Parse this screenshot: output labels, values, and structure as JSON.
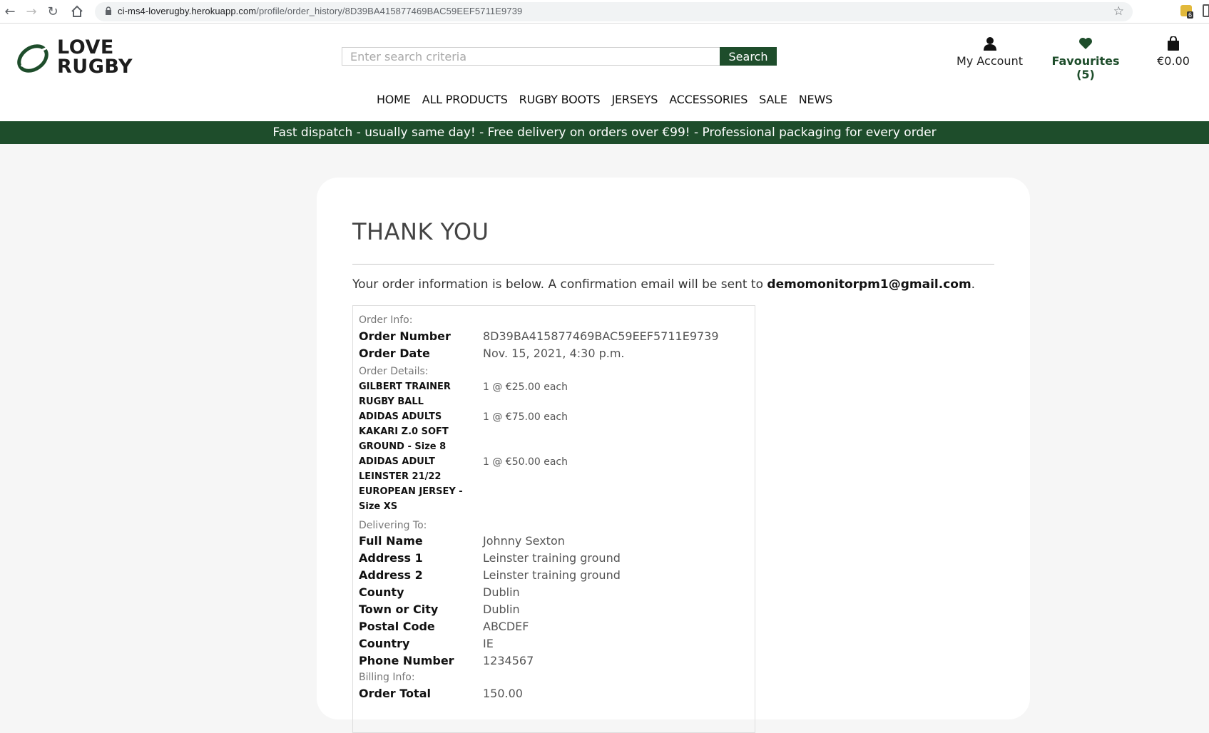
{
  "browser": {
    "url_domain": "ci-ms4-loverugby.herokuapp.com",
    "url_path": "/profile/order_history/8D39BA415877469BAC59EEF5711E9739",
    "extension_badge": "6"
  },
  "header": {
    "logo_line1": "LOVE",
    "logo_line2": "RUGBY",
    "search_placeholder": "Enter search criteria",
    "search_button": "Search",
    "account_label": "My Account",
    "favourites_label": "Favourites (5)",
    "bag_total": "€0.00"
  },
  "nav": {
    "items": [
      "HOME",
      "ALL PRODUCTS",
      "RUGBY BOOTS",
      "JERSEYS",
      "ACCESSORIES",
      "SALE",
      "NEWS"
    ]
  },
  "banner": {
    "text": "Fast dispatch - usually same day! - Free delivery on orders over €99! - Professional packaging for every order"
  },
  "page": {
    "title": "THANK YOU",
    "intro_text": "Your order information is below. A confirmation email will be sent to ",
    "email": "demomonitorpm1@gmail.com",
    "intro_end": "."
  },
  "order": {
    "order_info_label": "Order Info:",
    "order_number_label": "Order Number",
    "order_number": "8D39BA415877469BAC59EEF5711E9739",
    "order_date_label": "Order Date",
    "order_date": "Nov. 15, 2021, 4:30 p.m.",
    "order_details_label": "Order Details:",
    "items": [
      {
        "name": "GILBERT TRAINER RUGBY BALL",
        "qty": "1 @ €25.00 each"
      },
      {
        "name": "ADIDAS ADULTS KAKARI Z.0 SOFT GROUND - Size 8",
        "qty": "1 @ €75.00 each"
      },
      {
        "name": "ADIDAS ADULT LEINSTER 21/22 EUROPEAN JERSEY - Size XS",
        "qty": "1 @ €50.00 each"
      }
    ],
    "delivering_label": "Delivering To:",
    "delivery": [
      {
        "label": "Full Name",
        "value": "Johnny Sexton"
      },
      {
        "label": "Address 1",
        "value": "Leinster training ground"
      },
      {
        "label": "Address 2",
        "value": "Leinster training ground"
      },
      {
        "label": "County",
        "value": "Dublin"
      },
      {
        "label": "Town or City",
        "value": "Dublin"
      },
      {
        "label": "Postal Code",
        "value": "ABCDEF"
      },
      {
        "label": "Country",
        "value": "IE"
      },
      {
        "label": "Phone Number",
        "value": "1234567"
      }
    ],
    "billing_label": "Billing Info:",
    "order_total_label": "Order Total",
    "order_total": "150.00"
  },
  "colors": {
    "brand_green": "#1e4d2b"
  }
}
